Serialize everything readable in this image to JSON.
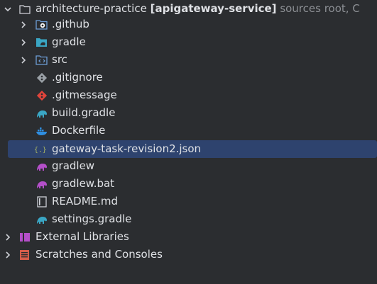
{
  "project": {
    "name": "architecture-practice",
    "module": "[apigateway-service]",
    "hint": "sources root,  C"
  },
  "items": [
    {
      "label": ".github",
      "icon": "folder-github-icon"
    },
    {
      "label": "gradle",
      "icon": "folder-gradle-icon"
    },
    {
      "label": "src",
      "icon": "folder-source-icon"
    },
    {
      "label": ".gitignore",
      "icon": "gitignore-icon"
    },
    {
      "label": ".gitmessage",
      "icon": "git-icon"
    },
    {
      "label": "build.gradle",
      "icon": "gradle-elephant-icon"
    },
    {
      "label": "Dockerfile",
      "icon": "docker-icon"
    },
    {
      "label": "gateway-task-revision2.json",
      "icon": "json-icon"
    },
    {
      "label": "gradlew",
      "icon": "gradlew-icon"
    },
    {
      "label": "gradlew.bat",
      "icon": "gradlew-bat-icon"
    },
    {
      "label": "README.md",
      "icon": "markdown-icon"
    },
    {
      "label": "settings.gradle",
      "icon": "gradle-settings-icon"
    }
  ],
  "bottom": [
    {
      "label": "External Libraries",
      "icon": "library-icon"
    },
    {
      "label": "Scratches and Consoles",
      "icon": "scratches-icon"
    }
  ],
  "colors": {
    "background": "#2b2d30",
    "selection": "#2e436e",
    "text": "#dfe1e5",
    "hint": "#8c8f94",
    "gradle": "#3aa6c4",
    "gradlew": "#b44fc9",
    "git": "#e0443b",
    "json": "#a9b665"
  }
}
